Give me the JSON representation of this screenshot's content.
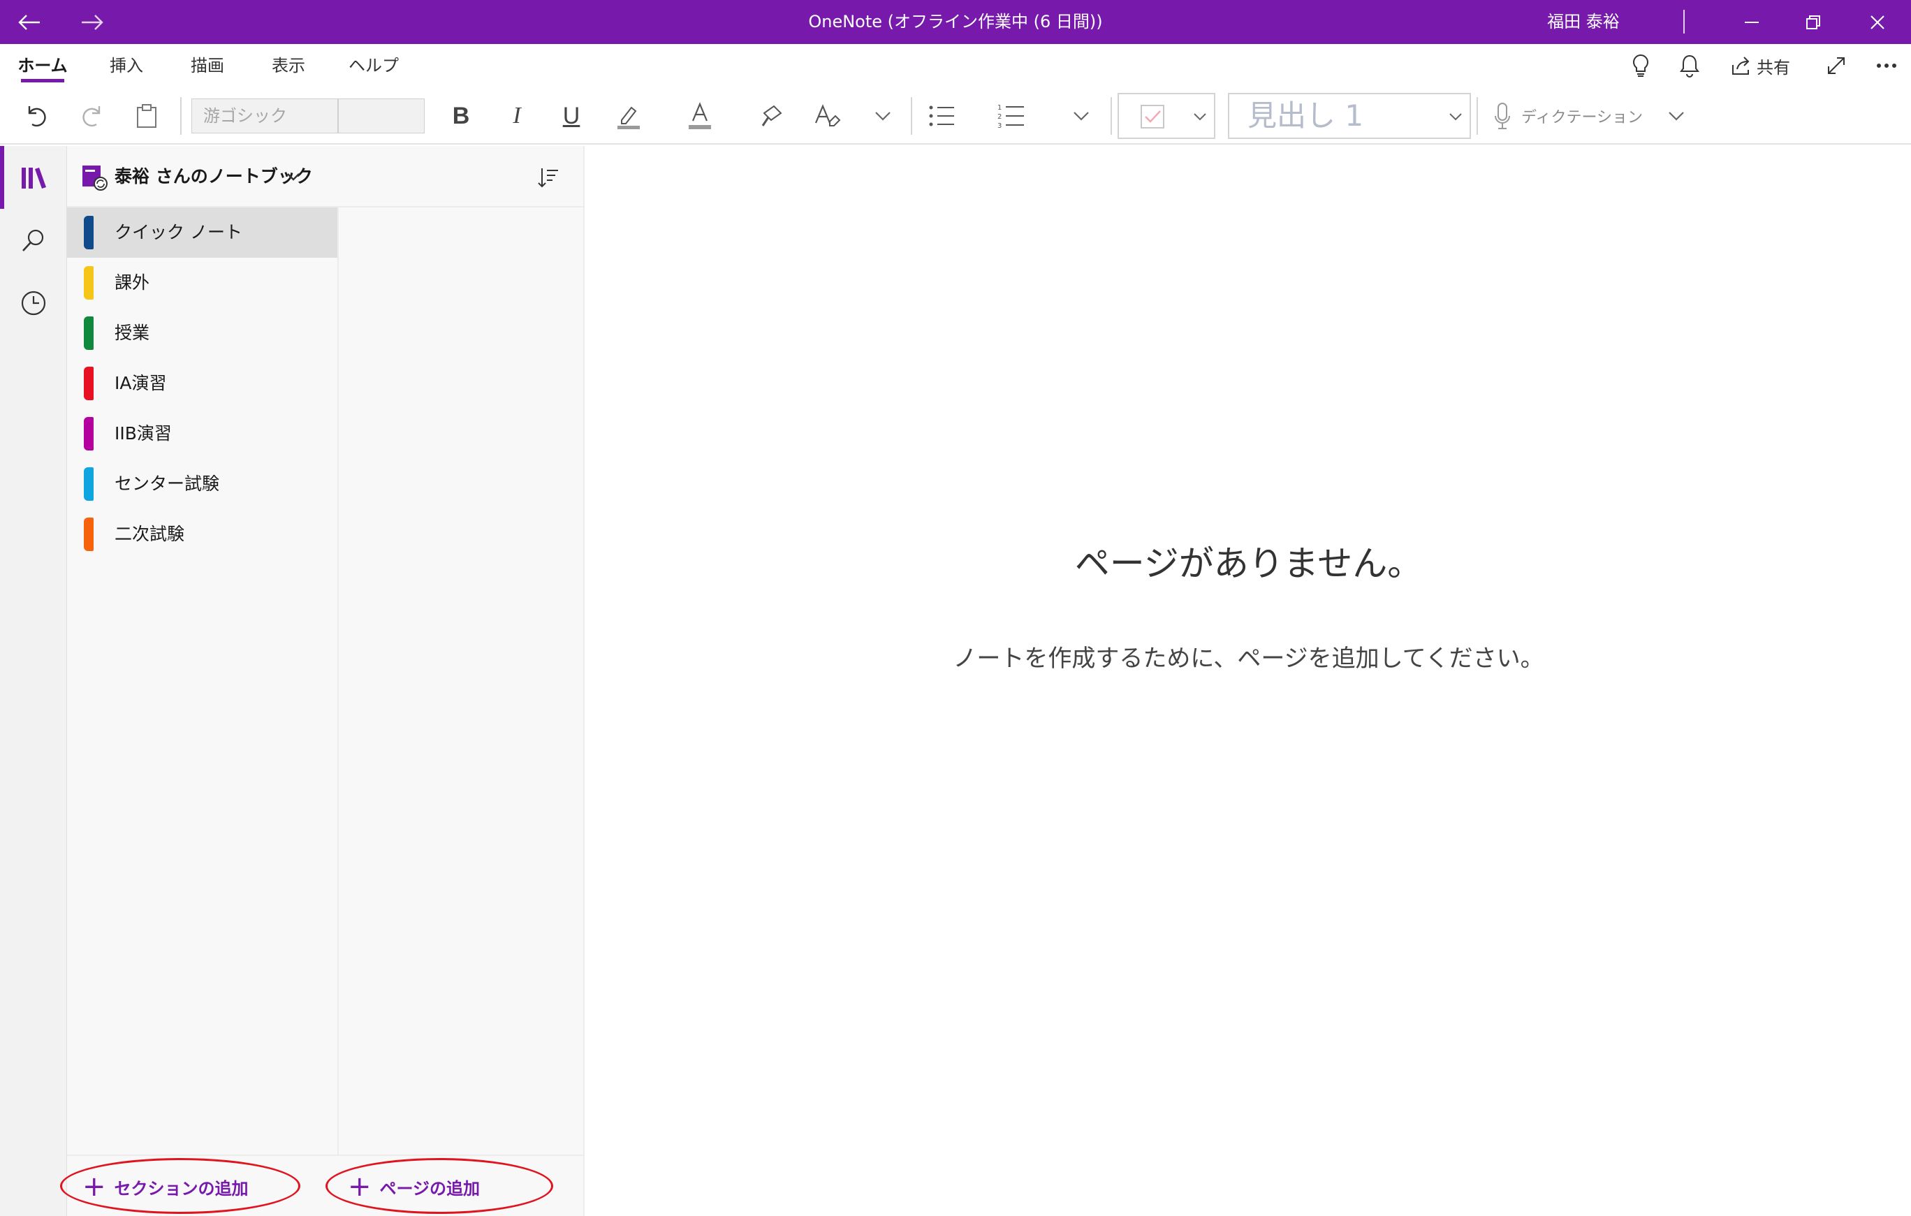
{
  "window": {
    "title": "OneNote (オフライン作業中 (6 日間))",
    "user": "福田 泰裕"
  },
  "ribbon": {
    "tabs": [
      "ホーム",
      "挿入",
      "描画",
      "表示",
      "ヘルプ"
    ],
    "share_label": "共有"
  },
  "toolbar": {
    "font_name": "游ゴシック",
    "font_size": "",
    "bold_label": "B",
    "italic_label": "I",
    "underline_label": "U",
    "font_color_label": "A",
    "style_value": "見出し 1",
    "dictation_label": "ディクテーション"
  },
  "notebook": {
    "name": "泰裕 さんのノートブック",
    "sections": [
      {
        "label": "クイック ノート",
        "color": "#0f4a8a",
        "selected": true
      },
      {
        "label": "課外",
        "color": "#f5c518",
        "selected": false
      },
      {
        "label": "授業",
        "color": "#10893e",
        "selected": false
      },
      {
        "label": "IA演習",
        "color": "#e81123",
        "selected": false
      },
      {
        "label": "IIB演習",
        "color": "#b4009e",
        "selected": false
      },
      {
        "label": "センター試験",
        "color": "#0ea5e0",
        "selected": false
      },
      {
        "label": "二次試験",
        "color": "#f7630c",
        "selected": false
      }
    ]
  },
  "bottom": {
    "add_section": "セクションの追加",
    "add_page": "ページの追加"
  },
  "canvas": {
    "empty_title": "ページがありません。",
    "empty_subtitle": "ノートを作成するために、ページを追加してください。"
  },
  "colors": {
    "accent": "#7719aa",
    "highlight_ellipse": "#e0141e"
  }
}
